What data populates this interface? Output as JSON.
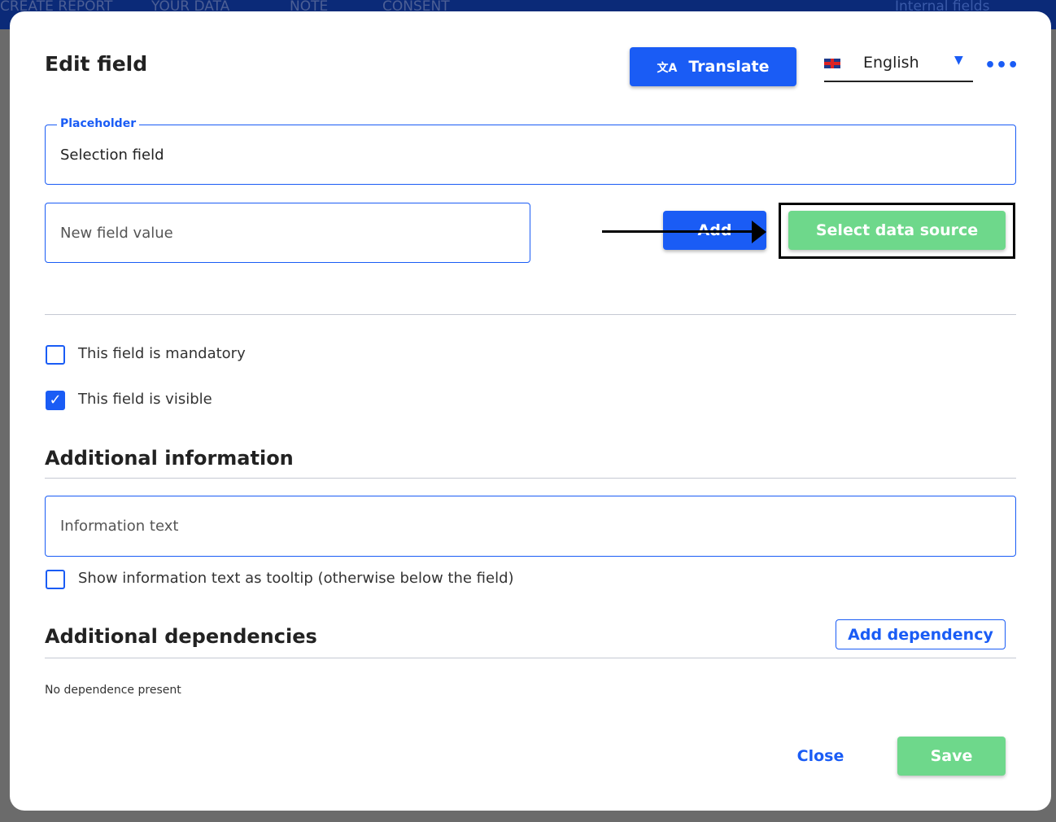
{
  "background": {
    "nav": [
      "CREATE REPORT",
      "YOUR DATA",
      "NOTE",
      "CONSENT"
    ],
    "internal_fields": "Internal fields"
  },
  "modal": {
    "title": "Edit field",
    "translate_label": "Translate",
    "language": "English",
    "placeholder_legend": "Placeholder",
    "placeholder_value": "Selection field",
    "new_value_placeholder": "New field value",
    "add_label": "Add",
    "select_source_label": "Select data source",
    "mandatory_label": "This field is mandatory",
    "mandatory_checked": false,
    "visible_label": "This field is visible",
    "visible_checked": true,
    "additional_info_title": "Additional information",
    "info_placeholder": "Information text",
    "tooltip_label": "Show information text as tooltip (otherwise below the field)",
    "tooltip_checked": false,
    "dependencies_title": "Additional dependencies",
    "add_dependency_label": "Add dependency",
    "no_dependence": "No dependence present",
    "close_label": "Close",
    "save_label": "Save"
  },
  "colors": {
    "primary": "#1a5cf5",
    "success": "#6ed88b"
  }
}
